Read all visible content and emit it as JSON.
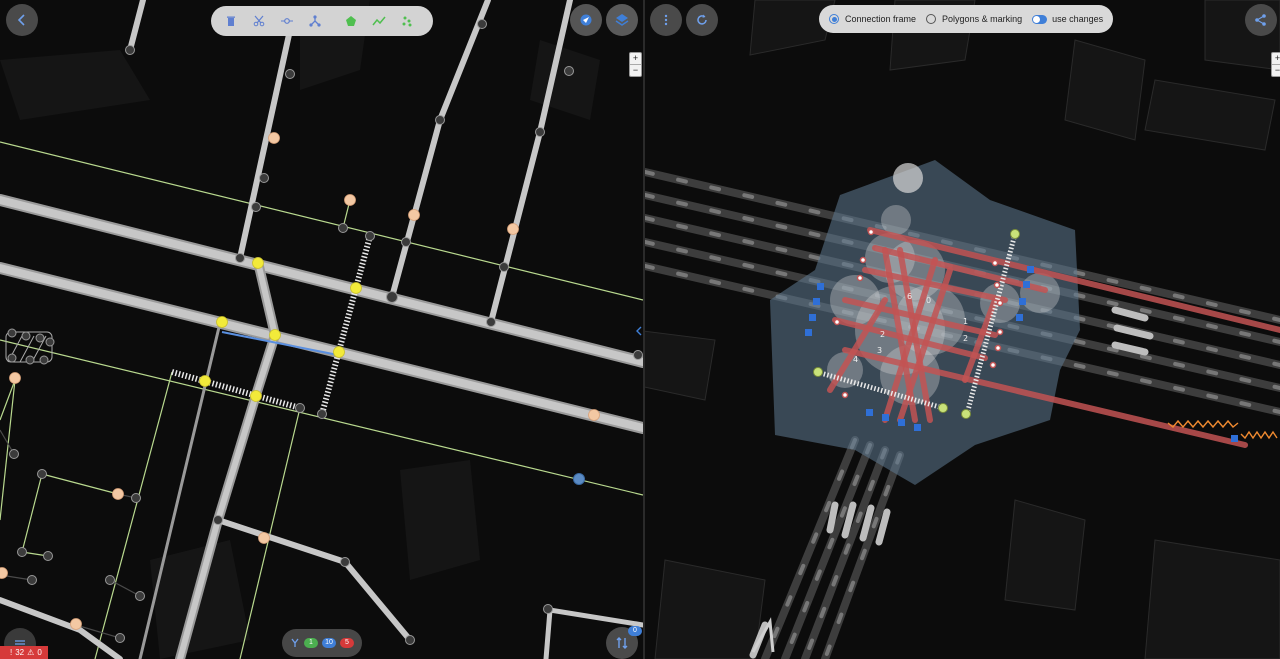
{
  "left_toolbar": {
    "tools": [
      {
        "name": "delete",
        "icon": "trash-icon"
      },
      {
        "name": "split",
        "icon": "scissors-icon"
      },
      {
        "name": "add-node",
        "icon": "node-icon"
      },
      {
        "name": "merge",
        "icon": "junction-icon"
      },
      {
        "name": "polygon",
        "icon": "polygon-icon"
      },
      {
        "name": "line",
        "icon": "polyline-icon"
      },
      {
        "name": "points",
        "icon": "points-icon"
      }
    ]
  },
  "mode_bar": {
    "connection_frame_label": "Connection frame",
    "polygons_label": "Polygons & marking",
    "use_changes_label": "use changes",
    "selected": "Connection frame",
    "use_changes": true
  },
  "bottom_pill": {
    "green_count": "1",
    "blue_count": "10",
    "red_count": "5"
  },
  "error_bar": {
    "error_count": "32",
    "warning_count": "0"
  },
  "left_badge": {
    "count": "0"
  },
  "intersection_numbers": [
    "6",
    "0",
    "1",
    "2",
    "2",
    "3",
    "4"
  ],
  "colors": {
    "accent": "#3f7fd8",
    "node_yellow": "#f2ea3a",
    "node_peach": "#f3c8a3",
    "edge_green": "#b9d98f",
    "lane_red": "#c25454",
    "area_blue": "#5e7a91"
  }
}
